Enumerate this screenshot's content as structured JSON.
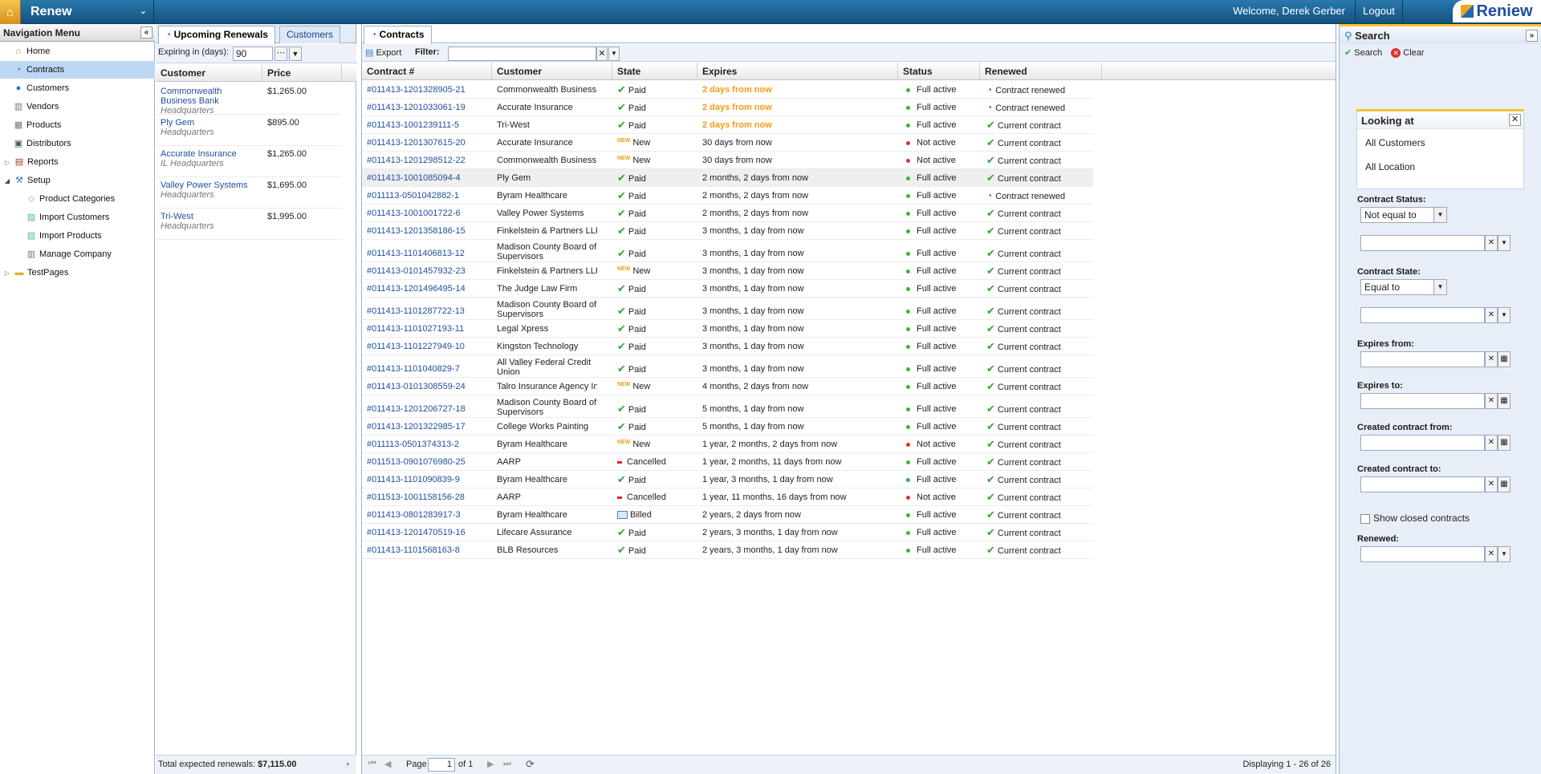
{
  "app": {
    "title": "Renew",
    "logo_text": "Reniew",
    "welcome": "Welcome, Derek Gerber",
    "logout": "Logout"
  },
  "nav": {
    "header": "Navigation Menu",
    "items": [
      {
        "label": "Home",
        "icon": "home-icon"
      },
      {
        "label": "Contracts",
        "icon": "contract-icon",
        "active": true
      },
      {
        "label": "Customers",
        "icon": "user-icon"
      },
      {
        "label": "Vendors",
        "icon": "building-icon"
      },
      {
        "label": "Products",
        "icon": "box-icon"
      },
      {
        "label": "Distributors",
        "icon": "truck-icon"
      },
      {
        "label": "Reports",
        "icon": "report-icon"
      },
      {
        "label": "Setup",
        "icon": "wrench-icon"
      },
      {
        "label": "Product Categories",
        "icon": "tag-icon"
      },
      {
        "label": "Import Customers",
        "icon": "import-icon"
      },
      {
        "label": "Import Products",
        "icon": "import-icon"
      },
      {
        "label": "Manage Company",
        "icon": "company-icon"
      },
      {
        "label": "TestPages",
        "icon": "folder-icon"
      }
    ]
  },
  "renewals": {
    "tabs": [
      "Upcoming Renewals",
      "Customers"
    ],
    "expiring_label": "Expiring in (days):",
    "expiring_value": "90",
    "columns": [
      "Customer",
      "Price"
    ],
    "rows": [
      {
        "customer": "Commonwealth Business Bank",
        "location": "Headquarters",
        "price": "$1,265.00"
      },
      {
        "customer": "Ply Gem",
        "location": "Headquarters",
        "price": "$895.00"
      },
      {
        "customer": "Accurate Insurance",
        "location": "IL Headquarters",
        "price": "$1,265.00"
      },
      {
        "customer": "Valley Power Systems",
        "location": "Headquarters",
        "price": "$1,695.00"
      },
      {
        "customer": "Tri-West",
        "location": "Headquarters",
        "price": "$1,995.00"
      }
    ],
    "total_label": "Total expected renewals:",
    "total_value": "$7,115.00"
  },
  "contracts": {
    "tab": "Contracts",
    "export": "Export",
    "filter_label": "Filter:",
    "columns": [
      "Contract #",
      "Customer",
      "State",
      "Expires",
      "Status",
      "Renewed"
    ],
    "rows": [
      {
        "id": "#011413-1201328905-21",
        "customer": "Commonwealth Business Bank",
        "state": "Paid",
        "expires": "2 days from now",
        "status": "Full active",
        "renewed": "Contract renewed"
      },
      {
        "id": "#011413-1201033061-19",
        "customer": "Accurate Insurance",
        "state": "Paid",
        "expires": "2 days from now",
        "status": "Full active",
        "renewed": "Contract renewed"
      },
      {
        "id": "#011413-1001239111-5",
        "customer": "Tri-West",
        "state": "Paid",
        "expires": "2 days from now",
        "status": "Full active",
        "renewed": "Current contract"
      },
      {
        "id": "#011413-1201307615-20",
        "customer": "Accurate Insurance",
        "state": "New",
        "expires": "30 days from now",
        "status": "Not active",
        "renewed": "Current contract"
      },
      {
        "id": "#011413-1201298512-22",
        "customer": "Commonwealth Business Bank",
        "state": "New",
        "expires": "30 days from now",
        "status": "Not active",
        "renewed": "Current contract"
      },
      {
        "id": "#011413-1001085094-4",
        "customer": "Ply Gem",
        "state": "Paid",
        "expires": "2 months, 2 days from now",
        "status": "Full active",
        "renewed": "Current contract"
      },
      {
        "id": "#011113-0501042882-1",
        "customer": "Byram Healthcare",
        "state": "Paid",
        "expires": "2 months, 2 days from now",
        "status": "Full active",
        "renewed": "Contract renewed"
      },
      {
        "id": "#011413-1001001722-6",
        "customer": "Valley Power Systems",
        "state": "Paid",
        "expires": "2 months, 2 days from now",
        "status": "Full active",
        "renewed": "Current contract"
      },
      {
        "id": "#011413-1201358186-15",
        "customer": "Finkelstein & Partners LLP",
        "state": "Paid",
        "expires": "3 months, 1 day from now",
        "status": "Full active",
        "renewed": "Current contract"
      },
      {
        "id": "#011413-1101406813-12",
        "customer": "Madison County Board of Supervisors",
        "state": "Paid",
        "expires": "3 months, 1 day from now",
        "status": "Full active",
        "renewed": "Current contract"
      },
      {
        "id": "#011413-0101457932-23",
        "customer": "Finkelstein & Partners LLP",
        "state": "New",
        "expires": "3 months, 1 day from now",
        "status": "Full active",
        "renewed": "Current contract"
      },
      {
        "id": "#011413-1201496495-14",
        "customer": "The Judge Law Firm",
        "state": "Paid",
        "expires": "3 months, 1 day from now",
        "status": "Full active",
        "renewed": "Current contract"
      },
      {
        "id": "#011413-1101287722-13",
        "customer": "Madison County Board of Supervisors",
        "state": "Paid",
        "expires": "3 months, 1 day from now",
        "status": "Full active",
        "renewed": "Current contract"
      },
      {
        "id": "#011413-1101027193-11",
        "customer": "Legal Xpress",
        "state": "Paid",
        "expires": "3 months, 1 day from now",
        "status": "Full active",
        "renewed": "Current contract"
      },
      {
        "id": "#011413-1101227949-10",
        "customer": "Kingston Technology",
        "state": "Paid",
        "expires": "3 months, 1 day from now",
        "status": "Full active",
        "renewed": "Current contract"
      },
      {
        "id": "#011413-1101040829-7",
        "customer": "All Valley Federal Credit Union",
        "state": "Paid",
        "expires": "3 months, 1 day from now",
        "status": "Full active",
        "renewed": "Current contract"
      },
      {
        "id": "#011413-0101308559-24",
        "customer": "Talro Insurance Agency Inc",
        "state": "New",
        "expires": "4 months, 2 days from now",
        "status": "Full active",
        "renewed": "Current contract"
      },
      {
        "id": "#011413-1201206727-18",
        "customer": "Madison County Board of Supervisors",
        "state": "Paid",
        "expires": "5 months, 1 day from now",
        "status": "Full active",
        "renewed": "Current contract"
      },
      {
        "id": "#011413-1201322985-17",
        "customer": "College Works Painting",
        "state": "Paid",
        "expires": "5 months, 1 day from now",
        "status": "Full active",
        "renewed": "Current contract"
      },
      {
        "id": "#011113-0501374313-2",
        "customer": "Byram Healthcare",
        "state": "New",
        "expires": "1 year, 2 months, 2 days from now",
        "status": "Not active",
        "renewed": "Current contract"
      },
      {
        "id": "#011513-0901076980-25",
        "customer": "AARP",
        "state": "Cancelled",
        "expires": "1 year, 2 months, 11 days from now",
        "status": "Full active",
        "renewed": "Current contract"
      },
      {
        "id": "#011413-1101090839-9",
        "customer": "Byram Healthcare",
        "state": "Paid",
        "expires": "1 year, 3 months, 1 day from now",
        "status": "Full active",
        "renewed": "Current contract"
      },
      {
        "id": "#011513-1001158156-28",
        "customer": "AARP",
        "state": "Cancelled",
        "expires": "1 year, 11 months, 16 days from now",
        "status": "Not active",
        "renewed": "Current contract"
      },
      {
        "id": "#011413-0801283917-3",
        "customer": "Byram Healthcare",
        "state": "Billed",
        "expires": "2 years, 2 days from now",
        "status": "Full active",
        "renewed": "Current contract"
      },
      {
        "id": "#011413-1201470519-16",
        "customer": "Lifecare Assurance",
        "state": "Paid",
        "expires": "2 years, 3 months, 1 day from now",
        "status": "Full active",
        "renewed": "Current contract"
      },
      {
        "id": "#011413-1101568163-8",
        "customer": "BLB Resources",
        "state": "Paid",
        "expires": "2 years, 3 months, 1 day from now",
        "status": "Full active",
        "renewed": "Current contract"
      }
    ],
    "pager": {
      "page_label": "Page",
      "page": "1",
      "of_label": "of 1",
      "display": "Displaying 1 - 26 of 26"
    }
  },
  "search": {
    "title": "Search",
    "search_btn": "Search",
    "clear_btn": "Clear",
    "looking_title": "Looking at",
    "looking_items": [
      "All Customers",
      "All Location"
    ],
    "status_label": "Contract Status:",
    "status_op": "Not equal to",
    "state_label": "Contract State:",
    "state_op": "Equal to",
    "expires_from": "Expires from:",
    "expires_to": "Expires to:",
    "created_from": "Created contract from:",
    "created_to": "Created contract to:",
    "show_closed": "Show closed contracts",
    "renewed_label": "Renewed:"
  },
  "colors": {
    "accent": "#1f4e9e",
    "header": "#2a79ad",
    "soon": "#f39c12",
    "ok": "#36a436",
    "bad": "#e03030"
  }
}
